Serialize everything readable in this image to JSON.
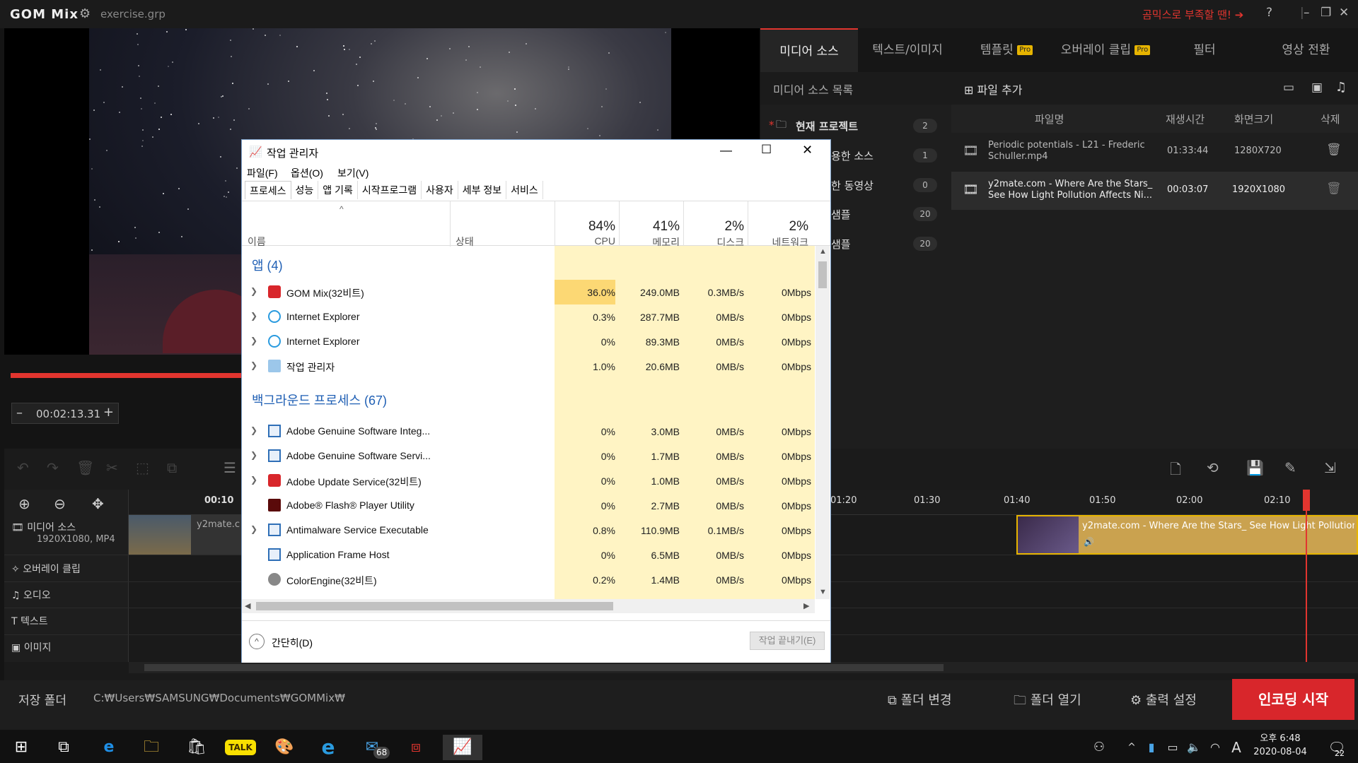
{
  "app": {
    "logo": "GOM Mix",
    "filename": "exercise.grp",
    "promo": "곰믹스로 부족할 땐! ➔",
    "help": "?",
    "minimize": "–",
    "restore": "❐",
    "close": "✕"
  },
  "preview": {
    "time": "00:02:13.31",
    "minus": "–",
    "plus": "+",
    "progress": 0.31
  },
  "right_tabs": [
    {
      "label": "미디어 소스",
      "active": true
    },
    {
      "label": "텍스트/이미지"
    },
    {
      "label": "템플릿",
      "pro": "Pro"
    },
    {
      "label": "오버레이 클립",
      "pro": "Pro"
    },
    {
      "label": "필터"
    },
    {
      "label": "영상 전환"
    }
  ],
  "media_list": {
    "title": "미디어 소스 목록",
    "items": [
      {
        "label": "현재 프로젝트",
        "count": "2"
      },
      {
        "label": "용한 소스",
        "count": "1"
      },
      {
        "label": "한 동영상",
        "count": "0"
      },
      {
        "label": "샘플",
        "count": "20"
      },
      {
        "label": "샘플",
        "count": "20"
      }
    ]
  },
  "file_panel": {
    "add_label": "파일 추가",
    "headers": [
      "파일명",
      "재생시간",
      "화면크기",
      "삭제"
    ],
    "rows": [
      {
        "name": "Periodic potentials - L21 - Frederic Schuller.mp4",
        "duration": "01:33:44",
        "size": "1280X720"
      },
      {
        "name": "y2mate.com - Where Are the Stars_ See How Light Pollution Affects Ni...",
        "duration": "00:03:07",
        "size": "1920X1080"
      }
    ]
  },
  "timeline": {
    "ruler": [
      "00:10",
      "01:20",
      "01:30",
      "01:40",
      "01:50",
      "02:00",
      "02:10"
    ],
    "tracks": [
      {
        "label": "미디어 소스",
        "sub": "1920X1080, MP4"
      },
      {
        "label": "오버레이 클립"
      },
      {
        "label": "오디오"
      },
      {
        "label": "텍스트"
      },
      {
        "label": "이미지"
      }
    ],
    "clip1": "y2mate.c",
    "clip2": "y2mate.com - Where Are the Stars_ See How Light Pollution"
  },
  "bottom": {
    "save_label": "저장 폴더",
    "save_path": "C:₩Users₩SAMSUNG₩Documents₩GOMMix₩",
    "change_folder": "폴더 변경",
    "open_folder": "폴더 열기",
    "output": "출력 설정",
    "encode": "인코딩 시작"
  },
  "task_manager": {
    "title": "작업 관리자",
    "menu": [
      "파일(F)",
      "옵션(O)",
      "보기(V)"
    ],
    "tabs": [
      "프로세스",
      "성능",
      "앱 기록",
      "시작프로그램",
      "사용자",
      "세부 정보",
      "서비스"
    ],
    "col_name": "이름",
    "col_status": "상태",
    "cols": [
      {
        "pct": "84%",
        "name": "CPU"
      },
      {
        "pct": "41%",
        "name": "메모리"
      },
      {
        "pct": "2%",
        "name": "디스크"
      },
      {
        "pct": "2%",
        "name": "네트워크"
      }
    ],
    "apps_group": "앱 (4)",
    "apps": [
      {
        "name": "GOM Mix(32비트)",
        "cpu": "36.0%",
        "mem": "249.0MB",
        "disk": "0.3MB/s",
        "net": "0Mbps"
      },
      {
        "name": "Internet Explorer",
        "cpu": "0.3%",
        "mem": "287.7MB",
        "disk": "0MB/s",
        "net": "0Mbps"
      },
      {
        "name": "Internet Explorer",
        "cpu": "0%",
        "mem": "89.3MB",
        "disk": "0MB/s",
        "net": "0Mbps"
      },
      {
        "name": "작업 관리자",
        "cpu": "1.0%",
        "mem": "20.6MB",
        "disk": "0MB/s",
        "net": "0Mbps"
      }
    ],
    "bg_group": "백그라운드 프로세스 (67)",
    "bg": [
      {
        "name": "Adobe Genuine Software Integ...",
        "cpu": "0%",
        "mem": "3.0MB",
        "disk": "0MB/s",
        "net": "0Mbps"
      },
      {
        "name": "Adobe Genuine Software Servi...",
        "cpu": "0%",
        "mem": "1.7MB",
        "disk": "0MB/s",
        "net": "0Mbps"
      },
      {
        "name": "Adobe Update Service(32비트)",
        "cpu": "0%",
        "mem": "1.0MB",
        "disk": "0MB/s",
        "net": "0Mbps"
      },
      {
        "name": "Adobe® Flash® Player Utility",
        "cpu": "0%",
        "mem": "2.7MB",
        "disk": "0MB/s",
        "net": "0Mbps"
      },
      {
        "name": "Antimalware Service Executable",
        "cpu": "0.8%",
        "mem": "110.9MB",
        "disk": "0.1MB/s",
        "net": "0Mbps"
      },
      {
        "name": "Application Frame Host",
        "cpu": "0%",
        "mem": "6.5MB",
        "disk": "0MB/s",
        "net": "0Mbps"
      },
      {
        "name": "ColorEngine(32비트)",
        "cpu": "0.2%",
        "mem": "1.4MB",
        "disk": "0MB/s",
        "net": "0Mbps"
      }
    ],
    "fewer": "간단히(D)",
    "end_task": "작업 끝내기(E)"
  },
  "taskbar": {
    "mail_badge": "68",
    "clock_time": "오후 6:48",
    "clock_date": "2020-08-04",
    "notif": "22",
    "ime": "A"
  }
}
